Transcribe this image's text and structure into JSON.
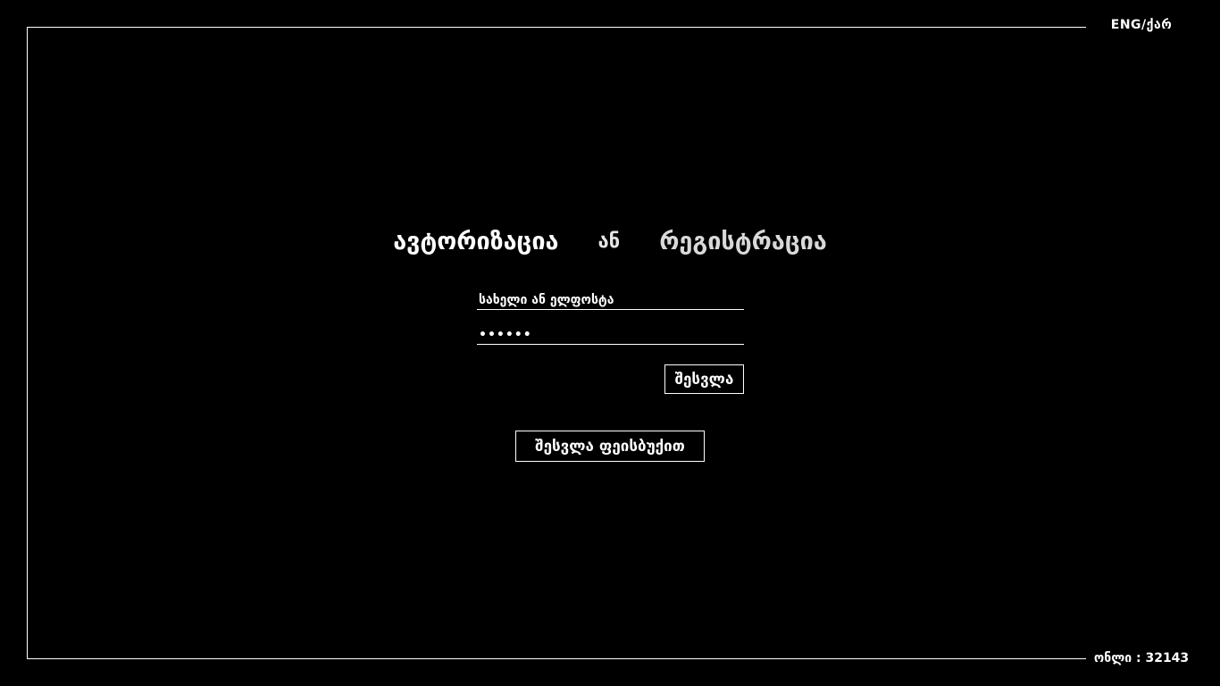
{
  "header": {
    "language_switch": "ENG/ქარ"
  },
  "tabs": {
    "login": "ავტორიზაცია",
    "separator": "ან",
    "register": "რეგისტრაცია"
  },
  "form": {
    "username_placeholder": "სახელი ან ელფოსტა",
    "username_value": "",
    "password_value": "••••••",
    "login_button": "შესვლა",
    "facebook_button": "შესვლა ფეისბუქით"
  },
  "footer": {
    "online_counter": "ონლი : 32143"
  },
  "colors": {
    "background": "#000000",
    "foreground": "#ffffff"
  }
}
